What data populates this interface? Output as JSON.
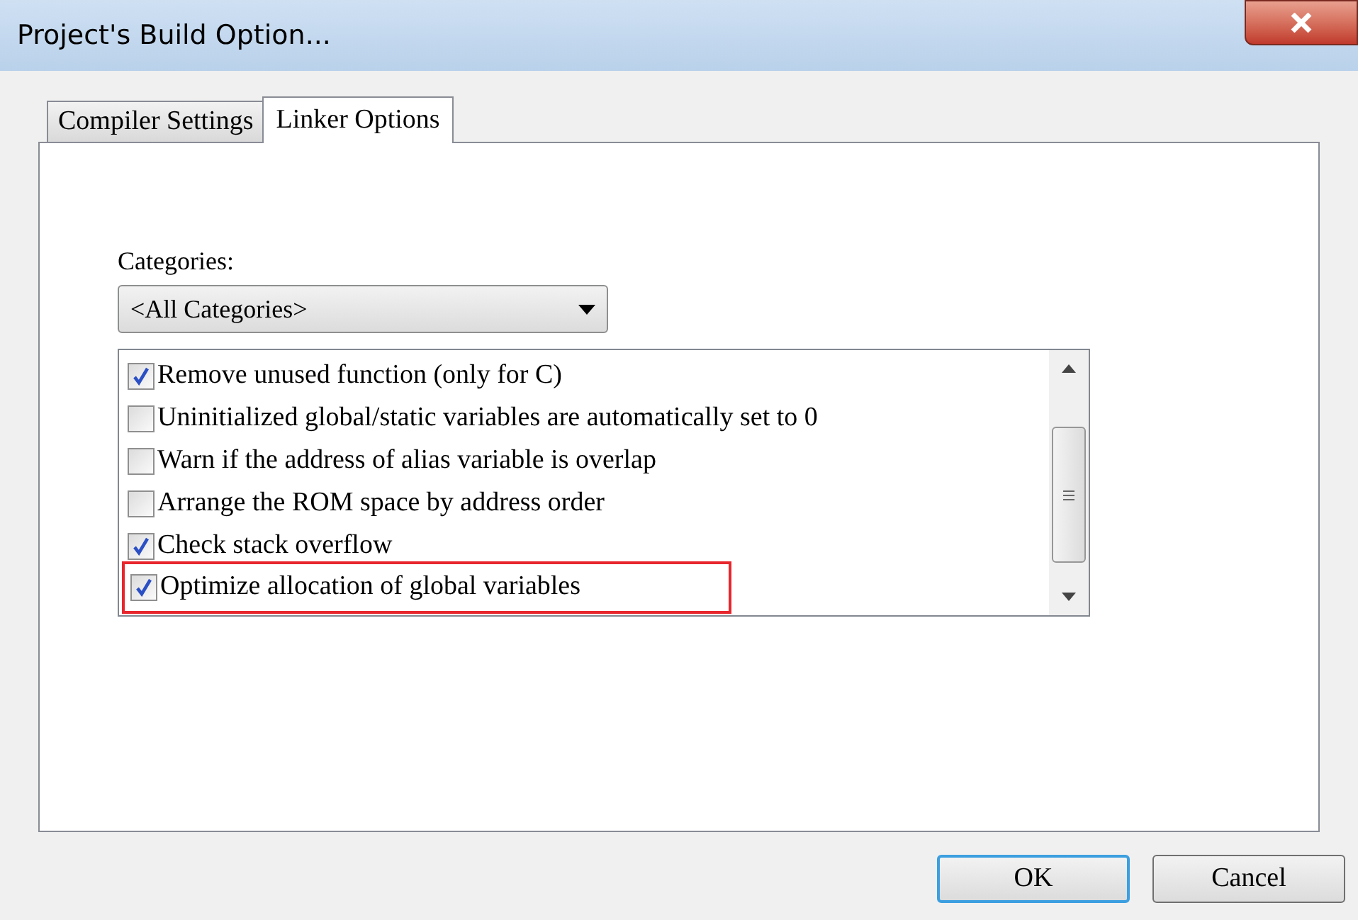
{
  "window": {
    "title": "Project's Build Option..."
  },
  "tabs": [
    {
      "label": "Compiler Settings",
      "selected": false
    },
    {
      "label": "Linker Options",
      "selected": true
    }
  ],
  "categories": {
    "label": "Categories:",
    "value": "<All Categories>"
  },
  "options": [
    {
      "label": "Remove unused function (only for C)",
      "checked": true,
      "highlighted": false
    },
    {
      "label": "Uninitialized global/static variables are automatically set to 0",
      "checked": false,
      "highlighted": false
    },
    {
      "label": "Warn if the address of alias variable is overlap",
      "checked": false,
      "highlighted": false
    },
    {
      "label": "Arrange the ROM space by address order",
      "checked": false,
      "highlighted": false
    },
    {
      "label": "Check stack overflow",
      "checked": true,
      "highlighted": false
    },
    {
      "label": "Optimize allocation of global variables",
      "checked": true,
      "highlighted": true
    }
  ],
  "buttons": [
    {
      "label": "OK",
      "default": true
    },
    {
      "label": "Cancel",
      "default": false
    }
  ]
}
